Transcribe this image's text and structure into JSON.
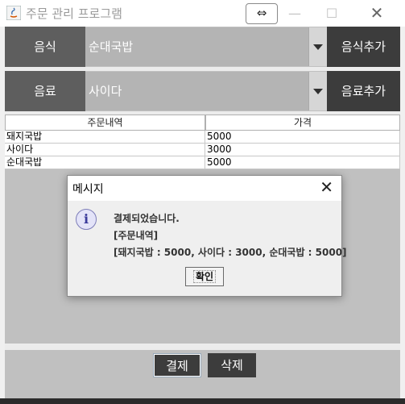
{
  "window": {
    "title": "주문 관리 프로그램",
    "swap_glyph": "⇔",
    "minimize_glyph": "—",
    "maximize_glyph": "☐",
    "close_glyph": "✕"
  },
  "food_row": {
    "label": "음식",
    "selected": "순대국밥",
    "add_button": "음식추가"
  },
  "drink_row": {
    "label": "음료",
    "selected": "사이다",
    "add_button": "음료추가"
  },
  "table": {
    "columns": [
      "주문내역",
      "가격"
    ],
    "rows": [
      [
        "돼지국밥",
        "5000"
      ],
      [
        "사이다",
        "3000"
      ],
      [
        "순대국밥",
        "5000"
      ]
    ]
  },
  "bottom": {
    "pay_button": "결제",
    "delete_button": "삭제"
  },
  "dialog": {
    "title": "메시지",
    "icon": "info-icon",
    "icon_glyph": "i",
    "lines": [
      "결제되었습니다.",
      "[주문내역]",
      "[돼지국밥 : 5000, 사이다 : 3000, 순대국밥 : 5000]"
    ],
    "ok_button": "확인",
    "close_glyph": "✕"
  },
  "colors": {
    "label_bg": "#5e5e5e",
    "button_bg": "#3c3c3c",
    "content_bg": "#c0c0c0"
  }
}
